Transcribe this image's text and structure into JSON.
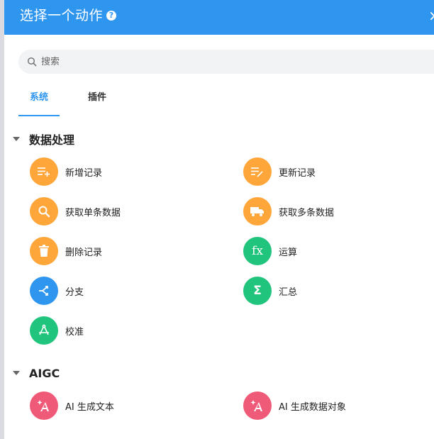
{
  "header": {
    "title": "选择一个动作",
    "help_icon": "question-circle-icon",
    "close_icon": "close-icon"
  },
  "search": {
    "placeholder": "搜索",
    "value": ""
  },
  "tabs": [
    {
      "label": "系统",
      "active": true
    },
    {
      "label": "插件",
      "active": false
    }
  ],
  "sections": [
    {
      "title": "数据处理",
      "items": [
        {
          "label": "新增记录",
          "icon": "list-add-icon",
          "color": "#ffa63a"
        },
        {
          "label": "更新记录",
          "icon": "list-edit-icon",
          "color": "#ffa63a"
        },
        {
          "label": "获取单条数据",
          "icon": "search-icon",
          "color": "#ffa63a"
        },
        {
          "label": "获取多条数据",
          "icon": "truck-icon",
          "color": "#ffa63a"
        },
        {
          "label": "删除记录",
          "icon": "trash-icon",
          "color": "#ffa63a"
        },
        {
          "label": "运算",
          "icon": "fx-icon",
          "color": "#20c47c"
        },
        {
          "label": "分支",
          "icon": "branch-icon",
          "color": "#2f96f0"
        },
        {
          "label": "汇总",
          "icon": "sigma-icon",
          "color": "#20c47c"
        },
        {
          "label": "校准",
          "icon": "calibrate-icon",
          "color": "#20c47c"
        }
      ]
    },
    {
      "title": "AIGC",
      "items": [
        {
          "label": "AI 生成文本",
          "icon": "ai-sparkle-icon",
          "color": "#ef5a78"
        },
        {
          "label": "AI 生成数据对象",
          "icon": "ai-sparkle-icon",
          "color": "#ef5a78"
        }
      ]
    }
  ],
  "colors": {
    "header": "#2f96f0",
    "accent": "#2f96f0",
    "orange": "#ffa63a",
    "green": "#20c47c",
    "pink": "#ef5a78"
  }
}
